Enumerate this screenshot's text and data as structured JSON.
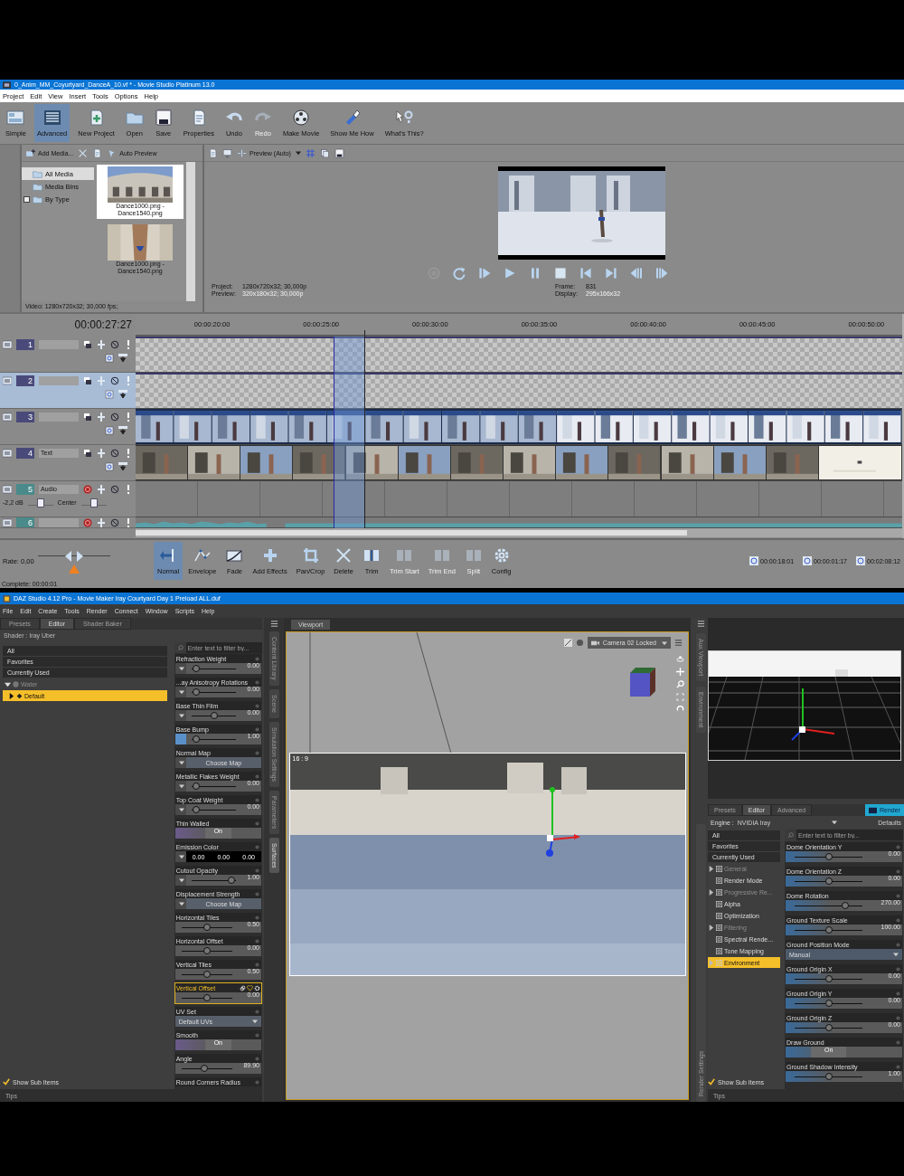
{
  "movie_studio": {
    "title": "0_Anim_MM_Coyurtyard_DanceA_10.vf * - Movie Studio Platinum 13.0",
    "menu": [
      "Project",
      "Edit",
      "View",
      "Insert",
      "Tools",
      "Options",
      "Help"
    ],
    "toolbar": [
      {
        "kind": "simple",
        "label": "Simple",
        "selected": false,
        "disabled": false
      },
      {
        "kind": "advanced",
        "label": "Advanced",
        "selected": true,
        "disabled": false
      },
      {
        "kind": "new",
        "label": "New Project",
        "selected": false,
        "disabled": false
      },
      {
        "kind": "open",
        "label": "Open",
        "selected": false,
        "disabled": false
      },
      {
        "kind": "save",
        "label": "Save",
        "selected": false,
        "disabled": false
      },
      {
        "kind": "properties",
        "label": "Properties",
        "selected": false,
        "disabled": false
      },
      {
        "kind": "undo",
        "label": "Undo",
        "selected": false,
        "disabled": false
      },
      {
        "kind": "redo",
        "label": "Redo",
        "selected": false,
        "disabled": true
      },
      {
        "kind": "movie",
        "label": "Make Movie",
        "selected": false,
        "disabled": false
      },
      {
        "kind": "showme",
        "label": "Show Me How",
        "selected": false,
        "disabled": false
      },
      {
        "kind": "whatsthis",
        "label": "What's This?",
        "selected": false,
        "disabled": false
      }
    ],
    "media": {
      "add_button": "Add Media...",
      "auto_preview": "Auto Preview",
      "tree": [
        {
          "label": "All Media",
          "selected": true,
          "expandable": false
        },
        {
          "label": "Media Bins",
          "selected": false,
          "expandable": false
        },
        {
          "label": "By Type",
          "selected": false,
          "expandable": true
        }
      ],
      "thumbnails": [
        {
          "kind": "courtyard",
          "caption": "Dance1000.png - Dance1540.png",
          "selected": true
        },
        {
          "kind": "figure",
          "caption": "Dance1000.png - Dance1540.png",
          "selected": false
        }
      ],
      "status": "Video: 1280x720x32; 30,000 fps;"
    },
    "preview": {
      "mode": "Preview (Auto)",
      "transport": [
        {
          "kind": "loop"
        },
        {
          "kind": "playstart"
        },
        {
          "kind": "play"
        },
        {
          "kind": "pause"
        },
        {
          "kind": "stop"
        },
        {
          "kind": "start"
        },
        {
          "kind": "end"
        },
        {
          "kind": "prevframe"
        },
        {
          "kind": "nextframe"
        }
      ],
      "info_left": [
        {
          "label": "Project:",
          "value": "1280x720x32; 30,000p"
        },
        {
          "label": "Preview:",
          "value": "320x180x32; 30,000p"
        }
      ],
      "info_right": [
        {
          "label": "Frame:",
          "value": "831"
        },
        {
          "label": "Display:",
          "value": "295x166x32"
        }
      ]
    },
    "timeline": {
      "timecode": "00:00:27:27",
      "ruler": [
        "00:00:20:00",
        "00:00:25:00",
        "00:00:30:00",
        "00:00:35:00",
        "00:00:40:00",
        "00:00:45:00",
        "00:00:50:00"
      ],
      "tracks": [
        {
          "number": "1",
          "kind": "video",
          "selected": false,
          "empty": true
        },
        {
          "number": "2",
          "kind": "video",
          "selected": true,
          "empty": true
        },
        {
          "number": "3",
          "kind": "video",
          "selected": false,
          "empty": false
        },
        {
          "number": "4",
          "name": "Text",
          "kind": "video",
          "selected": false,
          "empty": false
        },
        {
          "number": "5",
          "name": "Audio",
          "kind": "audio",
          "selected": false,
          "empty": false,
          "volume": "-2,2 dB",
          "pan": "Center"
        },
        {
          "number": "6",
          "kind": "audio",
          "selected": false,
          "empty": false,
          "waveform": true
        }
      ]
    },
    "bottom": {
      "rate": {
        "label": "Rate: 0,00",
        "level": 0.5
      },
      "tools": [
        {
          "kind": "normal",
          "label": "Normal",
          "selected": true,
          "disabled": false
        },
        {
          "kind": "envelope",
          "label": "Envelope",
          "selected": false,
          "disabled": false
        },
        {
          "kind": "fade",
          "label": "Fade",
          "selected": false,
          "disabled": false
        },
        {
          "kind": "effects",
          "label": "Add Effects",
          "selected": false,
          "disabled": false
        },
        {
          "kind": "pancrop",
          "label": "Pan/Crop",
          "selected": false,
          "disabled": false
        },
        {
          "kind": "delete",
          "label": "Delete",
          "selected": false,
          "disabled": false
        },
        {
          "kind": "trim",
          "label": "Trim",
          "selected": false,
          "disabled": false
        },
        {
          "kind": "trimstart",
          "label": "Trim Start",
          "selected": false,
          "disabled": true
        },
        {
          "kind": "trimend",
          "label": "Trim End",
          "selected": false,
          "disabled": true
        },
        {
          "kind": "split",
          "label": "Split",
          "selected": false,
          "disabled": true
        },
        {
          "kind": "config",
          "label": "Config",
          "selected": false,
          "disabled": false
        }
      ],
      "times": [
        "00:00:18:01",
        "00:00:01:17",
        "00:02:08:12"
      ],
      "status": "Complete: 00:00:01"
    }
  },
  "daz": {
    "title": "DAZ Studio 4.12 Pro - Movie Maker Iray Courtyard Day 1 Preload ALL.duf",
    "menu": [
      "File",
      "Edit",
      "Create",
      "Tools",
      "Render",
      "Connect",
      "Window",
      "Scripts",
      "Help"
    ],
    "surfaces": {
      "tabs": [
        {
          "label": "Presets",
          "selected": false
        },
        {
          "label": "Editor",
          "selected": true
        },
        {
          "label": "Shader Baker",
          "selected": false
        }
      ],
      "shader": "Shader : Iray Uber",
      "groups": [
        "All",
        "Favorites",
        "Currently Used"
      ],
      "tree": [
        {
          "label": "Water",
          "disabled": true,
          "expanded": true,
          "selected": false,
          "children": [
            {
              "label": "Default",
              "expanded": false,
              "selected": true
            }
          ]
        }
      ],
      "filter_placeholder": "Enter text to filter by...",
      "properties": [
        {
          "kind": "slider",
          "label": "Refraction Weight",
          "dropdown_arrow": true,
          "texture_swatch": false,
          "value": "0.00",
          "level": 0.1,
          "selected": false
        },
        {
          "kind": "slider",
          "label": "...ay Anisotropy Rotations",
          "dropdown_arrow": true,
          "texture_swatch": false,
          "value": "0.00",
          "level": 0.1,
          "selected": false
        },
        {
          "kind": "slider",
          "label": "Base Thin Film",
          "dropdown_arrow": true,
          "texture_swatch": false,
          "value": "0.00",
          "level": 0.5,
          "selected": false
        },
        {
          "kind": "slider",
          "label": "Base Bump",
          "dropdown_arrow": false,
          "texture_swatch": true,
          "value": "1.00",
          "level": 0.1,
          "selected": false
        },
        {
          "kind": "map",
          "label": "Normal Map",
          "dropdown_arrow": true,
          "texture_swatch": false,
          "value": "Choose Map",
          "selected": false
        },
        {
          "kind": "slider",
          "label": "Metallic Flakes Weight",
          "dropdown_arrow": true,
          "texture_swatch": false,
          "value": "0.00",
          "level": 0.1,
          "selected": false
        },
        {
          "kind": "slider",
          "label": "Top Coat Weight",
          "dropdown_arrow": true,
          "texture_swatch": false,
          "value": "0.00",
          "level": 0.1,
          "selected": false
        },
        {
          "kind": "toggle",
          "label": "Thin Walled",
          "dropdown_arrow": false,
          "texture_swatch": false,
          "value": "On",
          "on": true,
          "selected": false
        },
        {
          "kind": "color",
          "label": "Emission Color",
          "dropdown_arrow": true,
          "texture_swatch": false,
          "values": [
            "0.00",
            "0.00",
            "0.00"
          ],
          "selected": false
        },
        {
          "kind": "slider",
          "label": "Cutout Opacity",
          "dropdown_arrow": true,
          "texture_swatch": false,
          "value": "1.00",
          "level": 0.9,
          "selected": false
        },
        {
          "kind": "map",
          "label": "Displacement Strength",
          "dropdown_arrow": true,
          "texture_swatch": false,
          "value": "Choose Map",
          "selected": false
        },
        {
          "kind": "slider",
          "label": "Horizontal Tiles",
          "dropdown_arrow": false,
          "texture_swatch": false,
          "value": "0.50",
          "level": 0.5,
          "selected": false
        },
        {
          "kind": "slider",
          "label": "Horizontal Offset",
          "dropdown_arrow": false,
          "texture_swatch": false,
          "value": "0.00",
          "level": 0.5,
          "selected": false
        },
        {
          "kind": "slider",
          "label": "Vertical Tiles",
          "dropdown_arrow": false,
          "texture_swatch": false,
          "value": "0.50",
          "level": 0.5,
          "selected": false
        },
        {
          "kind": "slider",
          "label": "Vertical Offset",
          "dropdown_arrow": false,
          "texture_swatch": false,
          "value": "0.00",
          "level": 0.5,
          "selected": true
        },
        {
          "kind": "dropdown",
          "label": "UV Set",
          "dropdown_arrow": false,
          "texture_swatch": false,
          "value": "Default UVs",
          "selected": false
        },
        {
          "kind": "toggle",
          "label": "Smooth",
          "dropdown_arrow": false,
          "texture_swatch": false,
          "value": "On",
          "on": true,
          "selected": false
        },
        {
          "kind": "slider",
          "label": "Angle",
          "dropdown_arrow": false,
          "texture_swatch": false,
          "value": "89.90",
          "level": 0.45,
          "selected": false
        },
        {
          "kind": "label",
          "label": "Round Corners Radius",
          "selected": false
        }
      ],
      "show_sub_items": {
        "label": "Show Sub Items",
        "checked": true
      },
      "tips": "Tips"
    },
    "side_tabs": [
      {
        "label": "Content Library",
        "selected": false
      },
      {
        "label": "Scene",
        "selected": false
      },
      {
        "label": "Simulation Settings",
        "selected": false
      },
      {
        "label": "Parameters",
        "selected": false
      },
      {
        "label": "Surfaces",
        "selected": true
      }
    ],
    "viewport": {
      "tab": "Viewport",
      "camera": "Camera 02 Locked",
      "aspect": "16 : 9"
    },
    "aux_tabs": [
      "Aux Viewport",
      "Environment"
    ],
    "render": {
      "side_tab": "Render Settings",
      "tabs": [
        {
          "label": "Presets",
          "selected": false
        },
        {
          "label": "Editor",
          "selected": true
        },
        {
          "label": "Advanced",
          "selected": false
        }
      ],
      "render_button": "Render",
      "engine_label": "Engine :",
      "engine": "NVIDIA Iray",
      "defaults": "Defaults",
      "groups": [
        "All",
        "Favorites",
        "Currently Used"
      ],
      "sections": [
        {
          "label": "General",
          "disabled": true,
          "expandable": true,
          "selected": false
        },
        {
          "label": "Render Mode",
          "disabled": false,
          "expandable": false,
          "selected": false
        },
        {
          "label": "Progressive Re...",
          "disabled": true,
          "expandable": true,
          "selected": false
        },
        {
          "label": "Alpha",
          "disabled": false,
          "expandable": false,
          "selected": false
        },
        {
          "label": "Optimization",
          "disabled": false,
          "expandable": false,
          "selected": false
        },
        {
          "label": "Filtering",
          "disabled": true,
          "expandable": true,
          "selected": false
        },
        {
          "label": "Spectral Rende...",
          "disabled": false,
          "expandable": false,
          "selected": false
        },
        {
          "label": "Tone Mapping",
          "disabled": false,
          "expandable": false,
          "selected": false
        },
        {
          "label": "Environment",
          "disabled": false,
          "expandable": true,
          "selected": true
        }
      ],
      "filter_placeholder": "Enter text to filter by...",
      "properties": [
        {
          "kind": "slider",
          "label": "Dome Orientation Y",
          "value": "0.00",
          "level": 0.5,
          "selected": false
        },
        {
          "kind": "slider",
          "label": "Dome Orientation Z",
          "value": "0.00",
          "level": 0.5,
          "selected": false
        },
        {
          "kind": "slider",
          "label": "Dome Rotation",
          "value": "270.00",
          "level": 0.75,
          "selected": false
        },
        {
          "kind": "slider",
          "label": "Ground Texture Scale",
          "value": "100.00",
          "level": 0.5,
          "selected": false
        },
        {
          "kind": "dropdown",
          "label": "Ground Position Mode",
          "value": "Manual",
          "selected": false
        },
        {
          "kind": "slider",
          "label": "Ground Origin X",
          "value": "0.00",
          "level": 0.5,
          "selected": false
        },
        {
          "kind": "slider",
          "label": "Ground Origin Y",
          "value": "0.00",
          "level": 0.5,
          "selected": false
        },
        {
          "kind": "slider",
          "label": "Ground Origin Z",
          "value": "0.00",
          "level": 0.5,
          "selected": false
        },
        {
          "kind": "toggle",
          "label": "Draw Ground",
          "value": "On",
          "on": true,
          "selected": false
        },
        {
          "kind": "slider",
          "label": "Ground Shadow Intensity",
          "value": "1.00",
          "level": 0.5,
          "selected": false
        }
      ],
      "show_sub_items": {
        "label": "Show Sub Items",
        "checked": true
      },
      "tips": "Tips"
    }
  }
}
